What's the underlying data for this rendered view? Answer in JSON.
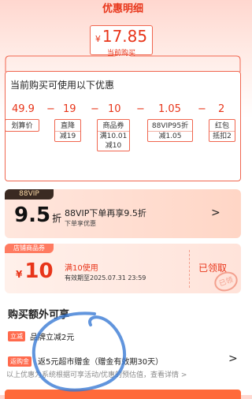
{
  "header": {
    "title": "优惠明细"
  },
  "current_price": {
    "currency": "¥",
    "amount": "17.85",
    "label": "当前购买"
  },
  "discounts": {
    "title": "当前购买可使用以下优惠",
    "numbers": [
      "49.9",
      "19",
      "10",
      "1.05",
      "2"
    ],
    "operators": [
      "−",
      "−",
      "−",
      "−"
    ],
    "tags": [
      {
        "line1": "划算价",
        "line2": ""
      },
      {
        "line1": "直降",
        "line2": "减19"
      },
      {
        "line1": "商品券",
        "line2": "满10.01\n减10"
      },
      {
        "line1": "88VIP95折",
        "line2": "减1.05"
      },
      {
        "line1": "红包",
        "line2": "抵扣2"
      }
    ]
  },
  "vip_card": {
    "badge": "88VIP",
    "discount": "9.5",
    "unit": "折",
    "main": "88VIP下单再享9.5折",
    "sub": "下单享优惠",
    "chevron": ">"
  },
  "coupon_card": {
    "badge": "店铺商品券",
    "currency": "¥",
    "amount": "10",
    "condition": "满10使用",
    "validity": "有效期至2025.07.31 23:59",
    "status": "已领取",
    "stamp": "已领"
  },
  "extra": {
    "title": "购买额外可享",
    "row1_pill": "立减",
    "row1_text": "品牌立减2元",
    "row2_pill": "返购金",
    "row2_text": "返5元超市赠金（赠金有效期30天）",
    "row2_chevron": ">",
    "footnote": "以上优惠为系统根据可享活动/优惠的预估值，查看详情 >"
  },
  "colors": {
    "accent": "#e8351a",
    "panel_border": "#f0664f"
  }
}
